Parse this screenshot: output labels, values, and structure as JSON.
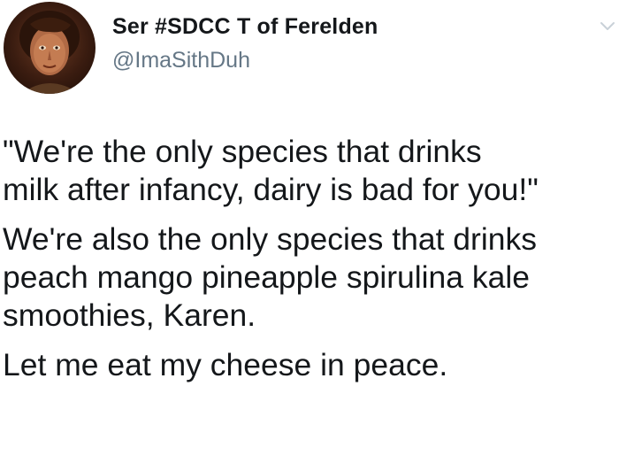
{
  "tweet": {
    "author": {
      "display_name": "Ser #SDCC T of Ferelden",
      "handle": "@ImaSithDuh",
      "avatar_icon": "profile-avatar"
    },
    "menu_icon": "chevron-down-icon",
    "paragraphs": [
      "\"We're the only species that drinks\nmilk after infancy, dairy is bad for you!\"",
      "We're also the only species that drinks\npeach mango pineapple spirulina kale\nsmoothies, Karen.",
      "Let me eat my cheese in peace."
    ]
  },
  "colors": {
    "name": "#14171a",
    "handle": "#657786",
    "background": "#ffffff"
  }
}
